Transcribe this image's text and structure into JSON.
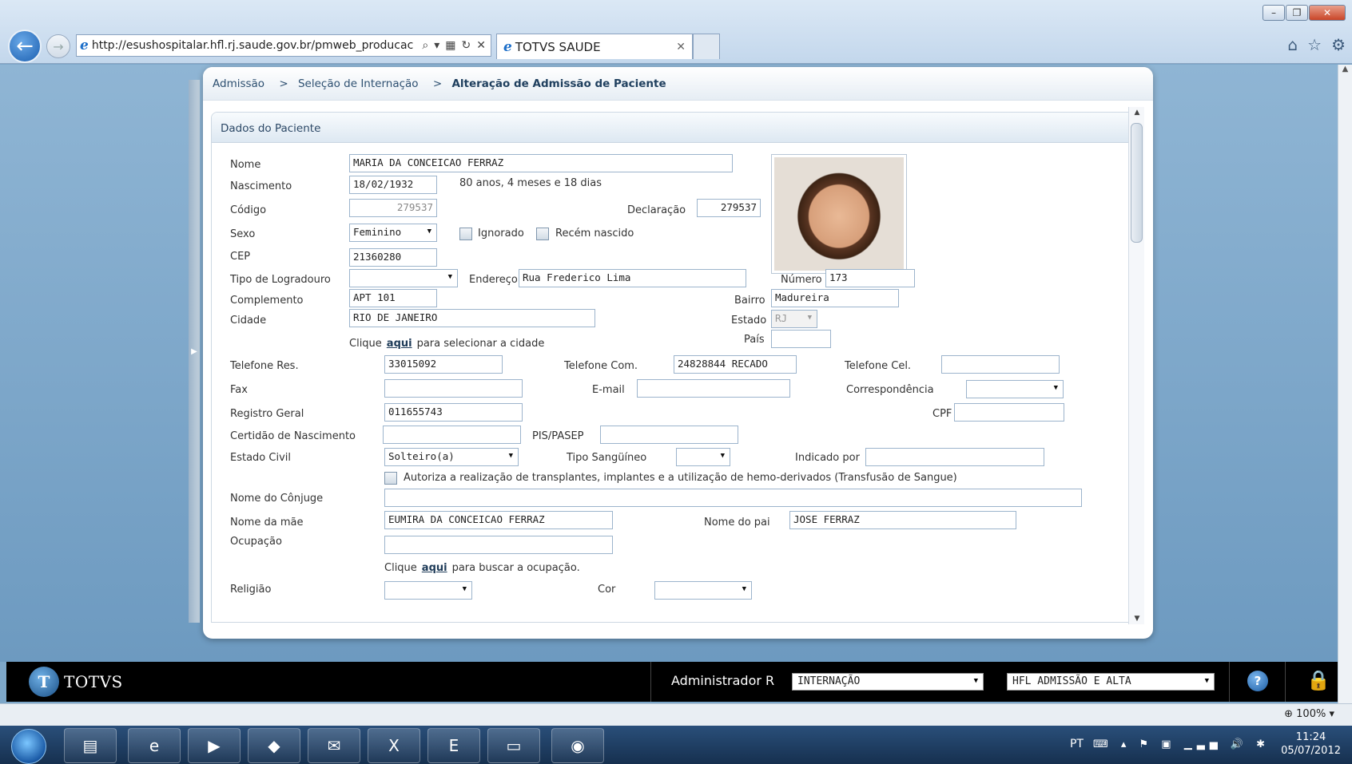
{
  "browser": {
    "url": "http://esushospitalar.hfl.rj.saude.gov.br/pmweb_producac",
    "tab_title": "TOTVS SAUDE"
  },
  "breadcrumb": {
    "items": [
      "Admissão",
      "Seleção de Internação"
    ],
    "current": "Alteração de Admissão de Paciente",
    "separator": ">"
  },
  "section": {
    "title": "Dados do Paciente"
  },
  "form": {
    "labels": {
      "nome": "Nome",
      "nascimento": "Nascimento",
      "codigo": "Código",
      "declaracao": "Declaração",
      "sexo": "Sexo",
      "ignorado": "Ignorado",
      "recem_nascido": "Recém nascido",
      "cep": "CEP",
      "tipo_logradouro": "Tipo de Logradouro",
      "endereco": "Endereço",
      "numero": "Número",
      "complemento": "Complemento",
      "bairro": "Bairro",
      "cidade": "Cidade",
      "estado": "Estado",
      "pais": "País",
      "clique": "Clique",
      "aqui": "aqui",
      "selecionar_cidade": "para selecionar a cidade",
      "buscar_ocupacao": "para buscar a ocupação.",
      "telefone_res": "Telefone Res.",
      "telefone_com": "Telefone Com.",
      "telefone_cel": "Telefone Cel.",
      "fax": "Fax",
      "email": "E-mail",
      "correspondencia": "Correspondência",
      "registro_geral": "Registro Geral",
      "cpf": "CPF",
      "certidao": "Certidão de Nascimento",
      "pis_pasep": "PIS/PASEP",
      "estado_civil": "Estado Civil",
      "tipo_sanguineo": "Tipo Sangüíneo",
      "indicado_por": "Indicado por",
      "autoriza": "Autoriza a realização de transplantes, implantes e a utilização de hemo-derivados (Transfusão de Sangue)",
      "nome_conjuge": "Nome do Cônjuge",
      "nome_mae": "Nome da mãe",
      "nome_pai": "Nome do pai",
      "ocupacao": "Ocupação",
      "religiao": "Religião",
      "cor": "Cor"
    },
    "values": {
      "nome": "MARIA DA CONCEICAO FERRAZ",
      "nascimento": "18/02/1932",
      "idade": "80 anos, 4 meses e 18 dias",
      "codigo": "279537",
      "declaracao": "279537",
      "sexo": "Feminino",
      "cep": "21360280",
      "tipo_logradouro": "",
      "endereco": "Rua Frederico Lima",
      "numero": "173",
      "complemento": "APT 101",
      "bairro": "Madureira",
      "cidade": "RIO DE JANEIRO",
      "estado": "RJ",
      "pais": "",
      "telefone_res": "33015092",
      "telefone_com": "24828844 RECADO",
      "telefone_cel": "",
      "fax": "",
      "email": "",
      "correspondencia": "",
      "registro_geral": "011655743",
      "cpf": "",
      "certidao": "",
      "pis_pasep": "",
      "estado_civil": "Solteiro(a)",
      "tipo_sanguineo": "",
      "indicado_por": "",
      "nome_conjuge": "",
      "nome_mae": "EUMIRA DA CONCEICAO FERRAZ",
      "nome_pai": "JOSE FERRAZ",
      "ocupacao": "",
      "religiao": "",
      "cor": ""
    }
  },
  "totvs_bar": {
    "logo": "TOTVS",
    "user": "Administrador R",
    "module": "INTERNAÇÃO",
    "profile": "HFL ADMISSÃO E ALTA"
  },
  "statusbar": {
    "zoom": "100%"
  },
  "taskbar": {
    "lang": "PT",
    "time": "11:24",
    "date": "05/07/2012"
  }
}
